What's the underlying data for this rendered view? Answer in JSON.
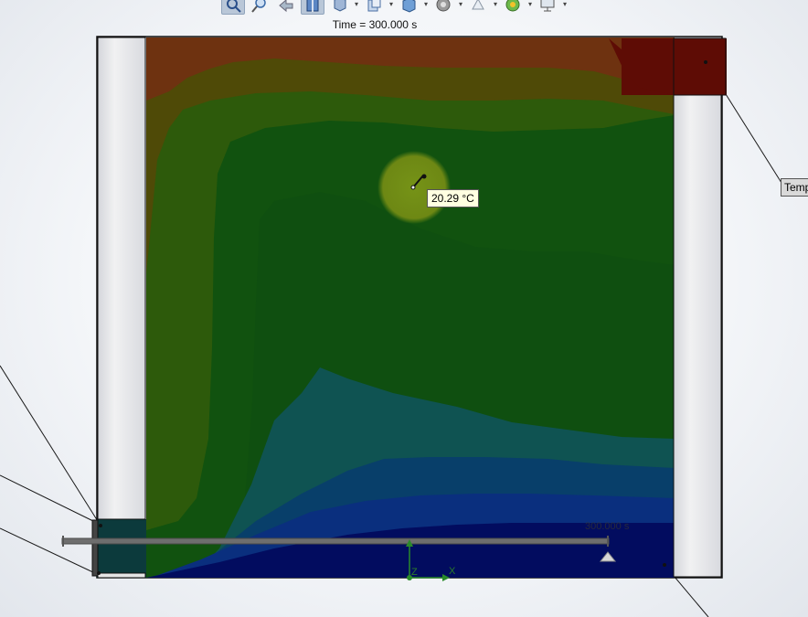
{
  "toolbar": {
    "buttons": [
      {
        "icon": "zoom-to-fit-icon",
        "active": true
      },
      {
        "icon": "zoom-area-icon",
        "active": false
      },
      {
        "icon": "previous-view-icon",
        "active": false
      },
      {
        "icon": "section-view-icon",
        "active": true
      },
      {
        "icon": "view-orientation-icon",
        "active": false
      },
      {
        "icon": "display-style-icon",
        "active": false
      },
      {
        "icon": "hide-show-items-icon",
        "active": false
      },
      {
        "icon": "edit-appearance-icon",
        "active": false
      },
      {
        "icon": "apply-scene-icon",
        "active": false
      },
      {
        "icon": "view-settings-icon",
        "active": false
      },
      {
        "icon": "monitor-icon",
        "active": false
      }
    ]
  },
  "header": {
    "time_label": "Time = 300.000 s"
  },
  "probe": {
    "value": "20.29 °C"
  },
  "sensor": {
    "label": "Temp"
  },
  "timeline": {
    "current": "300.000 s",
    "progress": 1.0
  },
  "triad": {
    "x_label": "X",
    "z_label": "Z"
  },
  "colors": {
    "hot_dark_red": "#5e0c05",
    "orange_brown": "#6e3210",
    "olive": "#4f4a07",
    "green_olive": "#2d5a0b",
    "green": "#11520f",
    "teal": "#0f5352",
    "dark_teal": "#083f6a",
    "blue": "#0a2f7e",
    "navy": "#020c5f",
    "wall_gray": "#e2e2e2",
    "probe_glow": "#c8c81e"
  }
}
